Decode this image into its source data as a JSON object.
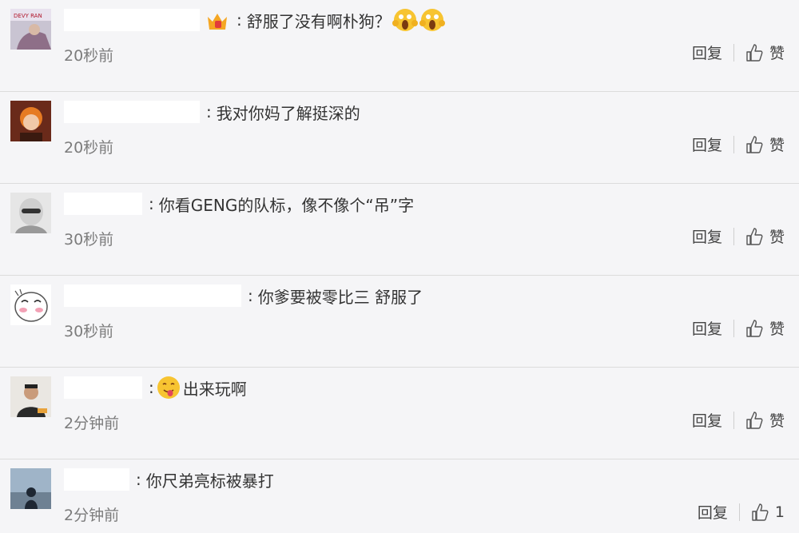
{
  "comments": [
    {
      "text": "舒服了没有啊朴狗？",
      "time": "20秒前",
      "reply": "回复",
      "like": "赞",
      "pre_emoji": "crown-badge-icon",
      "post_emoji": "scream-emoji-icon"
    },
    {
      "text": "我对你妈了解挺深的",
      "time": "20秒前",
      "reply": "回复",
      "like": "赞"
    },
    {
      "text": "你看GENG的队标，像不像个“吊”字",
      "time": "30秒前",
      "reply": "回复",
      "like": "赞"
    },
    {
      "text": "你爹要被零比三 舒服了",
      "time": "30秒前",
      "reply": "回复",
      "like": "赞"
    },
    {
      "text": "出来玩啊",
      "time": "2分钟前",
      "reply": "回复",
      "like": "赞",
      "pre_emoji": "tongue-emoji-icon"
    },
    {
      "text": "你尺弟亮标被暴打",
      "time": "2分钟前",
      "reply": "回复",
      "like": "1"
    }
  ],
  "colon": ":",
  "avatars": {
    "first_text": "DEVY RAN"
  },
  "colors": {
    "background": "#f5f5f7",
    "text": "#333333",
    "time": "#7c7c7c",
    "divider": "#dcdcdc"
  }
}
